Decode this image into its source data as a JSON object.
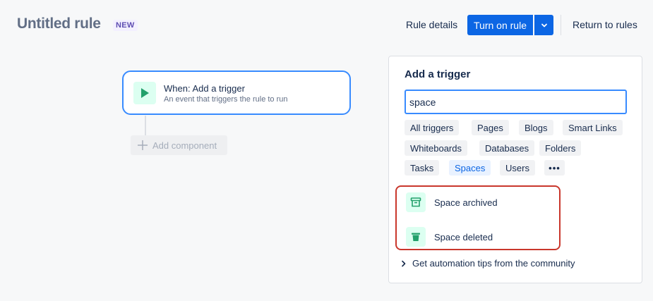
{
  "header": {
    "title": "Untitled rule",
    "badge": "NEW",
    "rule_details": "Rule details",
    "turn_on_rule": "Turn on rule",
    "return_to_rules": "Return to rules"
  },
  "canvas": {
    "trigger_title": "When: Add a trigger",
    "trigger_subtitle": "An event that triggers the rule to run",
    "add_component": "Add component"
  },
  "panel": {
    "title": "Add a trigger",
    "search_value": "space",
    "chips": [
      "All triggers",
      "Pages",
      "Blogs",
      "Smart Links",
      "Whiteboards",
      "Databases",
      "Folders",
      "Tasks",
      "Spaces",
      "Users",
      "•••"
    ],
    "active_chip": "Spaces",
    "results": [
      {
        "label": "Space archived",
        "icon": "archive-icon"
      },
      {
        "label": "Space deleted",
        "icon": "trash-icon"
      }
    ],
    "tips": "Get automation tips from the community"
  },
  "colors": {
    "primary": "#0c66e4",
    "focus": "#388bff",
    "highlight_border": "#c9372c",
    "icon_bg": "#dcfff1",
    "icon_green": "#22a06b"
  }
}
